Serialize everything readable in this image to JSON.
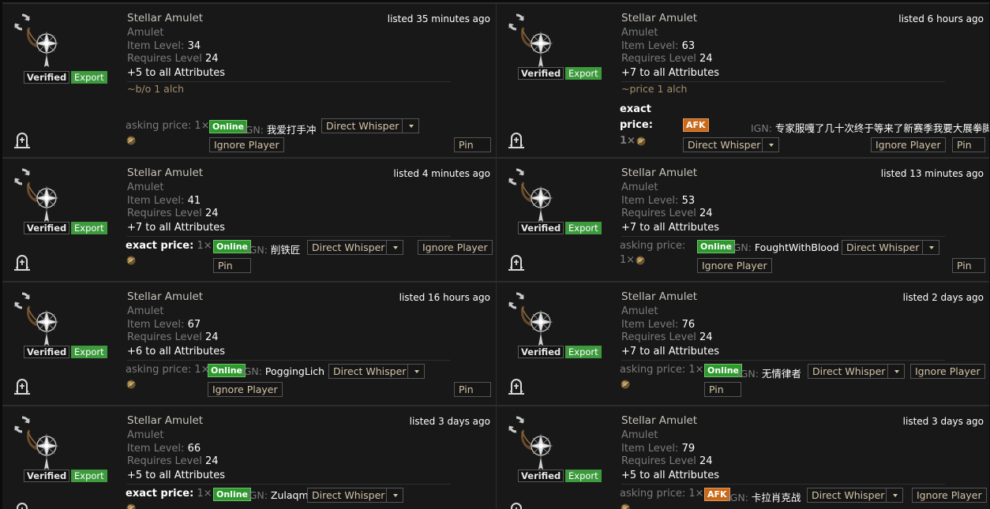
{
  "labels": {
    "verified": "Verified",
    "export": "Export",
    "direct_whisper": "Direct Whisper",
    "ignore_player": "Ignore Player",
    "pin": "Pin",
    "ign_prefix": "IGN:",
    "item_level": "Item Level:",
    "requires_level": "Requires Level",
    "asking_price": "asking price:",
    "exact_price": "exact price:"
  },
  "colors": {
    "online": "#2d9a2d",
    "afk": "#c96a1a",
    "export": "#3d9a3d",
    "bg": "#181818"
  },
  "listings": [
    {
      "name": "Stellar Amulet",
      "base": "Amulet",
      "item_level": "34",
      "requires_level": "24",
      "mod": "+5 to all Attributes",
      "note": "~b/o 1 alch",
      "listed": "listed 35 minutes ago",
      "price_label": "asking price:",
      "price_qty": "1×",
      "status": "Online",
      "ign": "我爱打手冲"
    },
    {
      "name": "Stellar Amulet",
      "base": "Amulet",
      "item_level": "63",
      "requires_level": "24",
      "mod": "+7 to all Attributes",
      "note": "~price 1 alch",
      "listed": "listed 6 hours ago",
      "price_label": "exact price:",
      "price_qty": "1×",
      "status": "AFK",
      "ign": "专家服嘎了几十次终于等来了新赛季我要大展拳脚"
    },
    {
      "name": "Stellar Amulet",
      "base": "Amulet",
      "item_level": "41",
      "requires_level": "24",
      "mod": "+7 to all Attributes",
      "note": "",
      "listed": "listed 4 minutes ago",
      "price_label": "exact price:",
      "price_qty": "1×",
      "status": "Online",
      "ign": "削铁匠"
    },
    {
      "name": "Stellar Amulet",
      "base": "Amulet",
      "item_level": "53",
      "requires_level": "24",
      "mod": "+7 to all Attributes",
      "note": "",
      "listed": "listed 13 minutes ago",
      "price_label": "asking price:",
      "price_qty": "1×",
      "status": "Online",
      "ign": "FoughtWithBlood"
    },
    {
      "name": "Stellar Amulet",
      "base": "Amulet",
      "item_level": "67",
      "requires_level": "24",
      "mod": "+6 to all Attributes",
      "note": "",
      "listed": "listed 16 hours ago",
      "price_label": "asking price:",
      "price_qty": "1×",
      "status": "Online",
      "ign": "PoggingLich"
    },
    {
      "name": "Stellar Amulet",
      "base": "Amulet",
      "item_level": "76",
      "requires_level": "24",
      "mod": "+7 to all Attributes",
      "note": "",
      "listed": "listed 2 days ago",
      "price_label": "asking price:",
      "price_qty": "1×",
      "status": "Online",
      "ign": "无情律者"
    },
    {
      "name": "Stellar Amulet",
      "base": "Amulet",
      "item_level": "66",
      "requires_level": "24",
      "mod": "+5 to all Attributes",
      "note": "",
      "listed": "listed 3 days ago",
      "price_label": "exact price:",
      "price_qty": "1×",
      "status": "Online",
      "ign": "Zulaqmerc"
    },
    {
      "name": "Stellar Amulet",
      "base": "Amulet",
      "item_level": "79",
      "requires_level": "24",
      "mod": "+5 to all Attributes",
      "note": "",
      "listed": "listed 3 days ago",
      "price_label": "asking price:",
      "price_qty": "1×",
      "status": "AFK",
      "ign": "卡拉肖克战"
    }
  ]
}
